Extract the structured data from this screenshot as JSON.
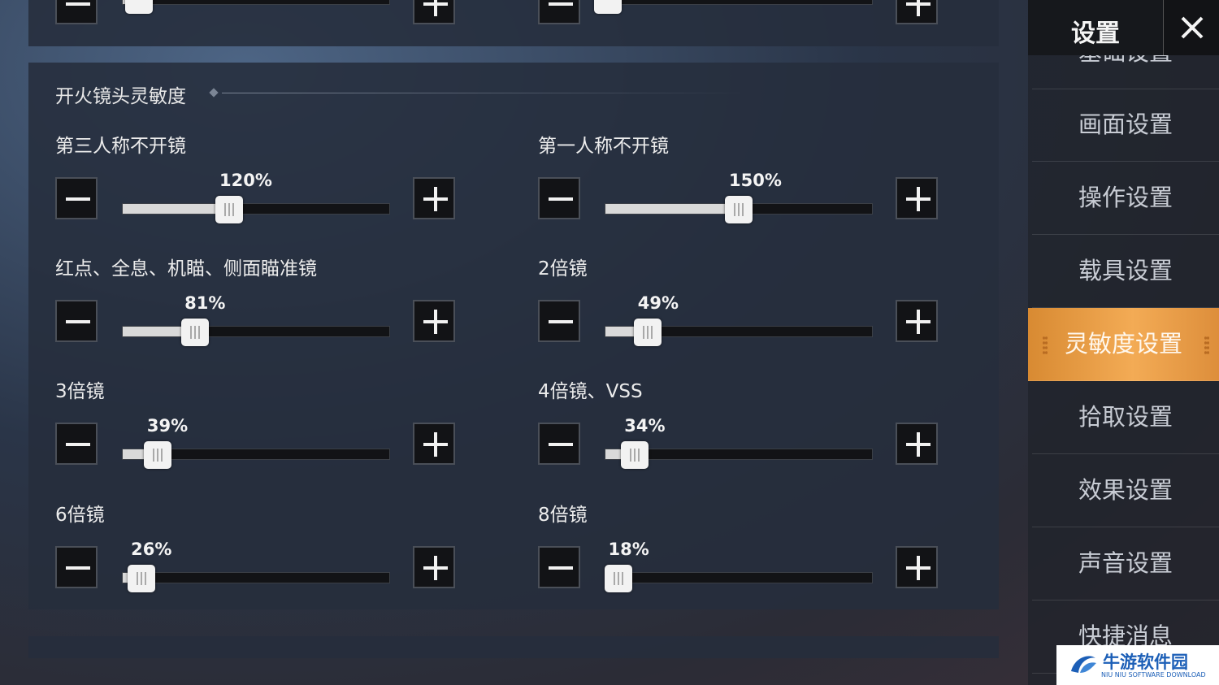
{
  "nav": {
    "title": "设置",
    "close_label": "close",
    "partial_top_item": "基础设置",
    "items": [
      {
        "label": "画面设置",
        "active": false
      },
      {
        "label": "操作设置",
        "active": false
      },
      {
        "label": "载具设置",
        "active": false
      },
      {
        "label": "灵敏度设置",
        "active": true
      },
      {
        "label": "拾取设置",
        "active": false
      },
      {
        "label": "效果设置",
        "active": false
      },
      {
        "label": "声音设置",
        "active": false
      },
      {
        "label": "快捷消息",
        "active": false
      }
    ]
  },
  "section": {
    "title": "开火镜头灵敏度",
    "settings": [
      {
        "label": "第三人称不开镜",
        "value": "120%",
        "level": 0.4
      },
      {
        "label": "第一人称不开镜",
        "value": "150%",
        "level": 0.5
      },
      {
        "label": "红点、全息、机瞄、侧面瞄准镜",
        "value": "81%",
        "level": 0.27
      },
      {
        "label": "2倍镜",
        "value": "49%",
        "level": 0.16
      },
      {
        "label": "3倍镜",
        "value": "39%",
        "level": 0.13
      },
      {
        "label": "4倍镜、VSS",
        "value": "34%",
        "level": 0.11
      },
      {
        "label": "6倍镜",
        "value": "26%",
        "level": 0.07
      },
      {
        "label": "8倍镜",
        "value": "18%",
        "level": 0.05
      }
    ]
  },
  "watermark": {
    "name": "牛游软件园",
    "subtitle": "NIU NIU SOFTWARE DOWNLOAD"
  },
  "colors": {
    "accent": "#f0a24c",
    "button_bg": "#121316",
    "panel_bg": "#262e3c",
    "watermark": "#1c5fb7"
  },
  "icons": [
    "minus-icon",
    "plus-icon",
    "close-icon",
    "slider-thumb-icon"
  ]
}
